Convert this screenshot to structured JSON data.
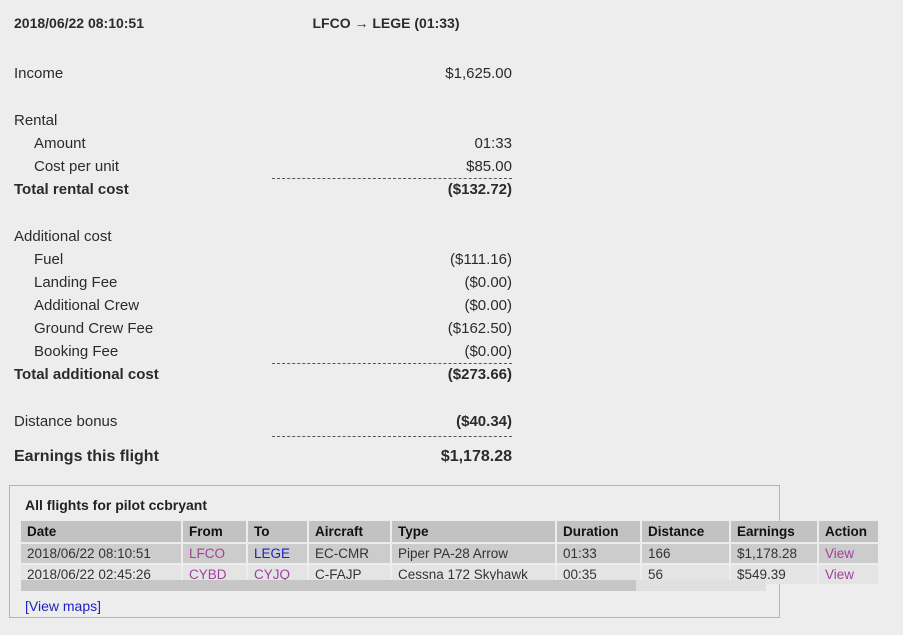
{
  "header": {
    "datetime": "2018/06/22 08:10:51",
    "route": "LFCO → LEGE (01:33)"
  },
  "summary": {
    "income": {
      "label": "Income",
      "value": "$1,625.00"
    },
    "rental": {
      "title": "Rental",
      "items": [
        {
          "label": "Amount",
          "value": "01:33"
        },
        {
          "label": "Cost per unit",
          "value": "$85.00"
        }
      ],
      "total": {
        "label": "Total rental cost",
        "value": "($132.72)"
      }
    },
    "additional": {
      "title": "Additional cost",
      "items": [
        {
          "label": "Fuel",
          "value": "($111.16)"
        },
        {
          "label": "Landing Fee",
          "value": "($0.00)"
        },
        {
          "label": "Additional Crew",
          "value": "($0.00)"
        },
        {
          "label": "Ground Crew Fee",
          "value": "($162.50)"
        },
        {
          "label": "Booking Fee",
          "value": "($0.00)"
        }
      ],
      "total": {
        "label": "Total additional cost",
        "value": "($273.66)"
      }
    },
    "distance_bonus": {
      "label": "Distance bonus",
      "value": "($40.34)"
    },
    "earnings": {
      "label": "Earnings this flight",
      "value": "$1,178.28"
    }
  },
  "flights_panel": {
    "title": "All flights for pilot ccbryant",
    "columns": [
      "Date",
      "From",
      "To",
      "Aircraft",
      "Type",
      "Duration",
      "Distance",
      "Earnings",
      "Action"
    ],
    "rows": [
      {
        "date": "2018/06/22 08:10:51",
        "from": "LFCO",
        "to": "LEGE",
        "aircraft": "EC-CMR",
        "type": "Piper PA-28 Arrow",
        "duration": "01:33",
        "distance": "166",
        "earnings": "$1,178.28",
        "action": "View"
      },
      {
        "date": "2018/06/22 02:45:26",
        "from": "CYBD",
        "to": "CYJQ",
        "aircraft": "C-FAJP",
        "type": "Cessna 172 Skyhawk",
        "duration": "00:35",
        "distance": "56",
        "earnings": "$549.39",
        "action": "View"
      }
    ],
    "view_maps_label": "[View maps]"
  },
  "colors": {
    "background": "#ededed",
    "link": "#2121c0",
    "link_visited": "#a0429a",
    "table_header": "#c2c2c2",
    "row_odd": "#cccccc",
    "row_even": "#e4e4e4"
  }
}
